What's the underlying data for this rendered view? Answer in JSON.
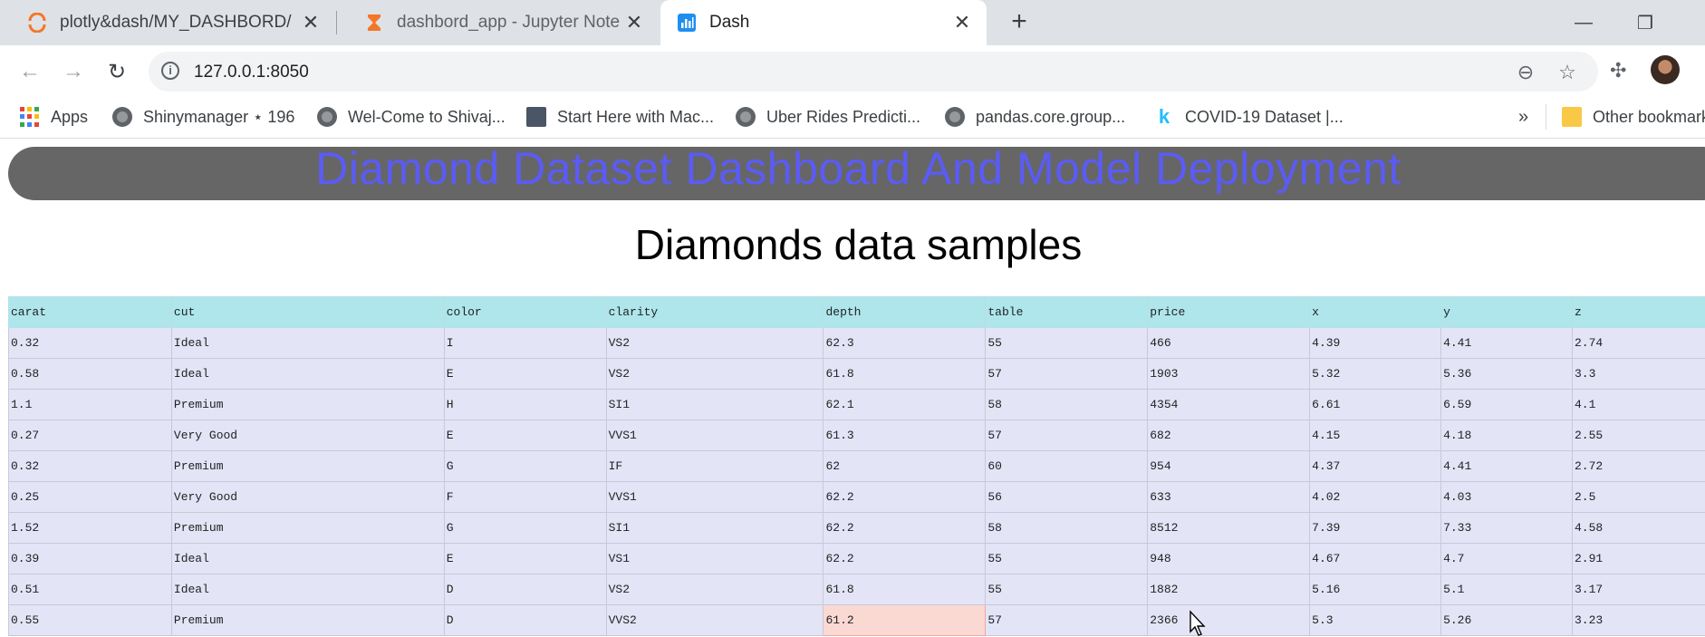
{
  "browser": {
    "tabs": [
      {
        "title": "plotly&dash/MY_DASHBORD/",
        "icon": "jupyter-logo-icon",
        "active": false
      },
      {
        "title": "dashbord_app - Jupyter Notebook",
        "icon": "hourglass-icon",
        "active": false
      },
      {
        "title": "Dash",
        "icon": "dash-chart-icon",
        "active": true
      }
    ],
    "address": "127.0.0.1:8050",
    "bookmarks": [
      {
        "label": "Apps",
        "icon": "apps-grid-icon"
      },
      {
        "label": "Shinymanager ⋆ 196",
        "icon": "globe-icon"
      },
      {
        "label": "Wel-Come to Shivaj...",
        "icon": "globe-icon"
      },
      {
        "label": "Start Here with Mac...",
        "icon": "person-thumbnail-icon"
      },
      {
        "label": "Uber Rides Predicti...",
        "icon": "globe-icon"
      },
      {
        "label": "pandas.core.group...",
        "icon": "globe-icon"
      },
      {
        "label": "COVID-19 Dataset |...",
        "icon": "kaggle-k-icon"
      },
      {
        "label": "Other bookmarks",
        "icon": "folder-icon"
      }
    ],
    "overflow_label": "»"
  },
  "page": {
    "banner_title": "Diamond Dataset Dashboard And Model Deployment",
    "subtitle": "Diamonds data samples",
    "colors": {
      "banner_bg": "#666666",
      "banner_text": "#5b5bf5",
      "header_bg": "#aee6ec",
      "cell_bg": "#e4e4f7",
      "selected_cell_bg": "#fbd9d3"
    },
    "table": {
      "columns": [
        "carat",
        "cut",
        "color",
        "clarity",
        "depth",
        "table",
        "price",
        "x",
        "y",
        "z"
      ],
      "rows": [
        [
          "0.32",
          "Ideal",
          "I",
          "VS2",
          "62.3",
          "55",
          "466",
          "4.39",
          "4.41",
          "2.74"
        ],
        [
          "0.58",
          "Ideal",
          "E",
          "VS2",
          "61.8",
          "57",
          "1903",
          "5.32",
          "5.36",
          "3.3"
        ],
        [
          "1.1",
          "Premium",
          "H",
          "SI1",
          "62.1",
          "58",
          "4354",
          "6.61",
          "6.59",
          "4.1"
        ],
        [
          "0.27",
          "Very Good",
          "E",
          "VVS1",
          "61.3",
          "57",
          "682",
          "4.15",
          "4.18",
          "2.55"
        ],
        [
          "0.32",
          "Premium",
          "G",
          "IF",
          "62",
          "60",
          "954",
          "4.37",
          "4.41",
          "2.72"
        ],
        [
          "0.25",
          "Very Good",
          "F",
          "VVS1",
          "62.2",
          "56",
          "633",
          "4.02",
          "4.03",
          "2.5"
        ],
        [
          "1.52",
          "Premium",
          "G",
          "SI1",
          "62.2",
          "58",
          "8512",
          "7.39",
          "7.33",
          "4.58"
        ],
        [
          "0.39",
          "Ideal",
          "E",
          "VS1",
          "62.2",
          "55",
          "948",
          "4.67",
          "4.7",
          "2.91"
        ],
        [
          "0.51",
          "Ideal",
          "D",
          "VS2",
          "61.8",
          "55",
          "1882",
          "5.16",
          "5.1",
          "3.17"
        ],
        [
          "0.55",
          "Premium",
          "D",
          "VVS2",
          "61.2",
          "57",
          "2366",
          "5.3",
          "5.26",
          "3.23"
        ]
      ],
      "selected_cell": {
        "row": 9,
        "column": "depth"
      }
    }
  }
}
